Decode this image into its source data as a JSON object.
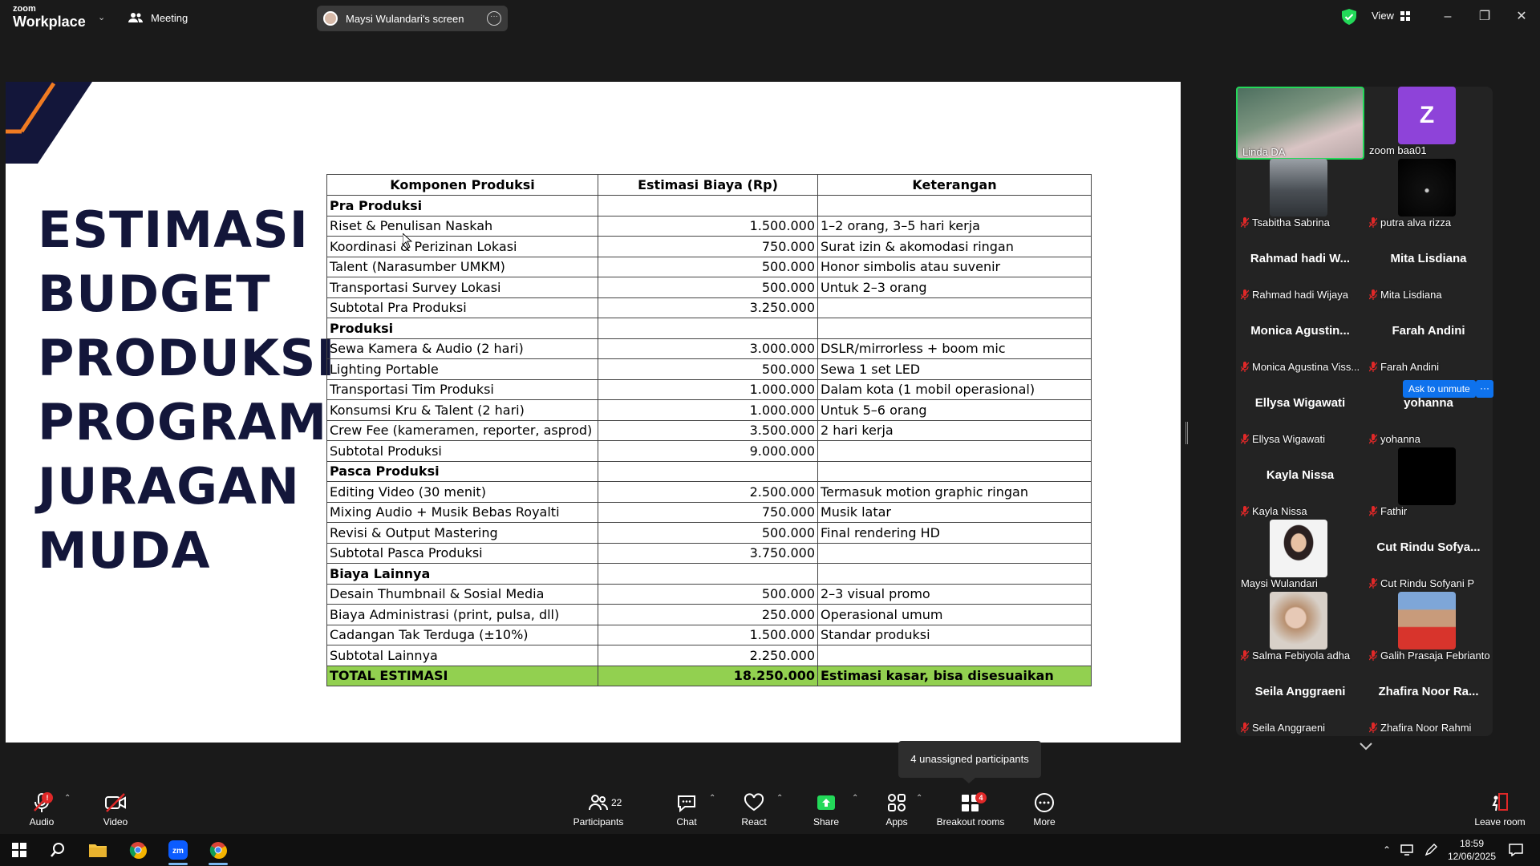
{
  "app": {
    "logo_line1": "zoom",
    "logo_line2": "Workplace",
    "meeting_label": "Meeting",
    "screen_tab_label": "Maysi Wulandari's screen",
    "view_label": "View"
  },
  "slide": {
    "title_lines": [
      "ESTIMASI",
      "BUDGET",
      "PRODUKSI",
      "PROGRAM",
      "JURAGAN",
      "MUDA"
    ],
    "table": {
      "headers": [
        "Komponen Produksi",
        "Estimasi Biaya (Rp)",
        "Keterangan"
      ],
      "rows": [
        {
          "type": "section",
          "cells": [
            "Pra Produksi",
            "",
            ""
          ]
        },
        {
          "type": "row",
          "cells": [
            "Riset & Penulisan Naskah",
            "1.500.000",
            "1–2 orang, 3–5 hari kerja"
          ]
        },
        {
          "type": "row",
          "cells": [
            "Koordinasi & Perizinan Lokasi",
            "750.000",
            "Surat izin & akomodasi ringan"
          ]
        },
        {
          "type": "row",
          "cells": [
            "Talent (Narasumber UMKM)",
            "500.000",
            "Honor simbolis atau suvenir"
          ]
        },
        {
          "type": "row",
          "cells": [
            "Transportasi Survey Lokasi",
            "500.000",
            "Untuk 2–3 orang"
          ]
        },
        {
          "type": "row",
          "cells": [
            "Subtotal Pra Produksi",
            "3.250.000",
            ""
          ]
        },
        {
          "type": "section",
          "cells": [
            "Produksi",
            "",
            ""
          ]
        },
        {
          "type": "row",
          "cells": [
            "Sewa Kamera & Audio (2 hari)",
            "3.000.000",
            "DSLR/mirrorless + boom mic"
          ]
        },
        {
          "type": "row",
          "cells": [
            "Lighting Portable",
            "500.000",
            "Sewa 1 set LED"
          ]
        },
        {
          "type": "row",
          "cells": [
            "Transportasi Tim Produksi",
            "1.000.000",
            "Dalam kota (1 mobil operasional)"
          ]
        },
        {
          "type": "row",
          "cells": [
            "Konsumsi Kru & Talent (2 hari)",
            "1.000.000",
            "Untuk 5–6 orang"
          ]
        },
        {
          "type": "row",
          "cells": [
            "Crew Fee (kameramen, reporter, asprod)",
            "3.500.000",
            "2 hari kerja"
          ]
        },
        {
          "type": "row",
          "cells": [
            "Subtotal Produksi",
            "9.000.000",
            ""
          ]
        },
        {
          "type": "section",
          "cells": [
            "Pasca Produksi",
            "",
            ""
          ]
        },
        {
          "type": "row",
          "cells": [
            "Editing Video (30 menit)",
            "2.500.000",
            "Termasuk motion graphic ringan"
          ]
        },
        {
          "type": "row",
          "cells": [
            "Mixing Audio + Musik Bebas Royalti",
            "750.000",
            "Musik latar"
          ]
        },
        {
          "type": "row",
          "cells": [
            "Revisi & Output Mastering",
            "500.000",
            "Final rendering HD"
          ]
        },
        {
          "type": "row",
          "cells": [
            "Subtotal Pasca Produksi",
            "3.750.000",
            ""
          ]
        },
        {
          "type": "section",
          "cells": [
            "Biaya Lainnya",
            "",
            ""
          ]
        },
        {
          "type": "row",
          "cells": [
            "Desain Thumbnail & Sosial Media",
            "500.000",
            "2–3 visual promo"
          ]
        },
        {
          "type": "row",
          "cells": [
            "Biaya Administrasi (print, pulsa, dll)",
            "250.000",
            "Operasional umum"
          ]
        },
        {
          "type": "row",
          "cells": [
            "Cadangan Tak Terduga (±10%)",
            "1.500.000",
            "Standar produksi"
          ]
        },
        {
          "type": "row",
          "cells": [
            "Subtotal Lainnya",
            "2.250.000",
            ""
          ]
        },
        {
          "type": "total",
          "cells": [
            "TOTAL ESTIMASI",
            "18.250.000",
            "Estimasi kasar, bisa disesuaikan"
          ]
        }
      ]
    }
  },
  "gallery": {
    "participants": [
      {
        "label": "Linda DA",
        "big_name": "",
        "kind": "video",
        "muted": false
      },
      {
        "label": "zoom baa01",
        "big_name": "",
        "kind": "avatar",
        "initial": "Z",
        "muted": false
      },
      {
        "label": "Tsabitha Sabrina",
        "big_name": "",
        "kind": "photo-car",
        "muted": true
      },
      {
        "label": "putra alva rizza",
        "big_name": "",
        "kind": "photo-dark",
        "muted": true
      },
      {
        "label": "Rahmad hadi Wijaya",
        "big_name": "Rahmad hadi W...",
        "kind": "name",
        "muted": true
      },
      {
        "label": "Mita Lisdiana",
        "big_name": "Mita Lisdiana",
        "kind": "name",
        "muted": true
      },
      {
        "label": "Monica Agustina Viss...",
        "big_name": "Monica Agustin...",
        "kind": "name",
        "muted": true
      },
      {
        "label": "Farah Andini",
        "big_name": "Farah Andini",
        "kind": "name",
        "muted": true
      },
      {
        "label": "Ellysa Wigawati",
        "big_name": "Ellysa Wigawati",
        "kind": "name",
        "muted": true
      },
      {
        "label": "yohanna",
        "big_name": "yohanna",
        "kind": "name",
        "muted": true
      },
      {
        "label": "Kayla Nissa",
        "big_name": "Kayla Nissa",
        "kind": "name",
        "muted": true
      },
      {
        "label": "Fathir",
        "big_name": "",
        "kind": "photo-black",
        "muted": true
      },
      {
        "label": "Maysi Wulandari",
        "big_name": "",
        "kind": "photo-person",
        "muted": false
      },
      {
        "label": "Cut Rindu Sofyani P",
        "big_name": "Cut Rindu Sofya...",
        "kind": "name",
        "muted": true
      },
      {
        "label": "Salma Febiyola adha",
        "big_name": "",
        "kind": "photo-person2",
        "muted": true
      },
      {
        "label": "Galih Prasaja Febrianto",
        "big_name": "",
        "kind": "photo-person3",
        "muted": true
      },
      {
        "label": "Seila Anggraeni",
        "big_name": "Seila Anggraeni",
        "kind": "name",
        "muted": true
      },
      {
        "label": "Zhafira Noor Rahmi",
        "big_name": "Zhafira Noor Ra...",
        "kind": "name",
        "muted": true
      }
    ],
    "ask_unmute_label": "Ask to unmute",
    "ask_more_label": "···"
  },
  "tooltip": {
    "text": "4 unassigned participants"
  },
  "toolbar": {
    "audio": "Audio",
    "video": "Video",
    "participants": "Participants",
    "participants_count": "22",
    "chat": "Chat",
    "react": "React",
    "share": "Share",
    "apps": "Apps",
    "breakout": "Breakout rooms",
    "breakout_badge": "4",
    "more": "More",
    "leave": "Leave room"
  },
  "taskbar": {
    "time": "18:59",
    "date": "12/06/2025"
  },
  "colors": {
    "accent_green": "#23d959",
    "zoom_blue": "#0e72ed",
    "total_row": "#92d050",
    "slide_navy": "#13163a",
    "slide_orange": "#f07b22",
    "avatar_purple": "#8e43d9",
    "danger": "#e02828"
  }
}
